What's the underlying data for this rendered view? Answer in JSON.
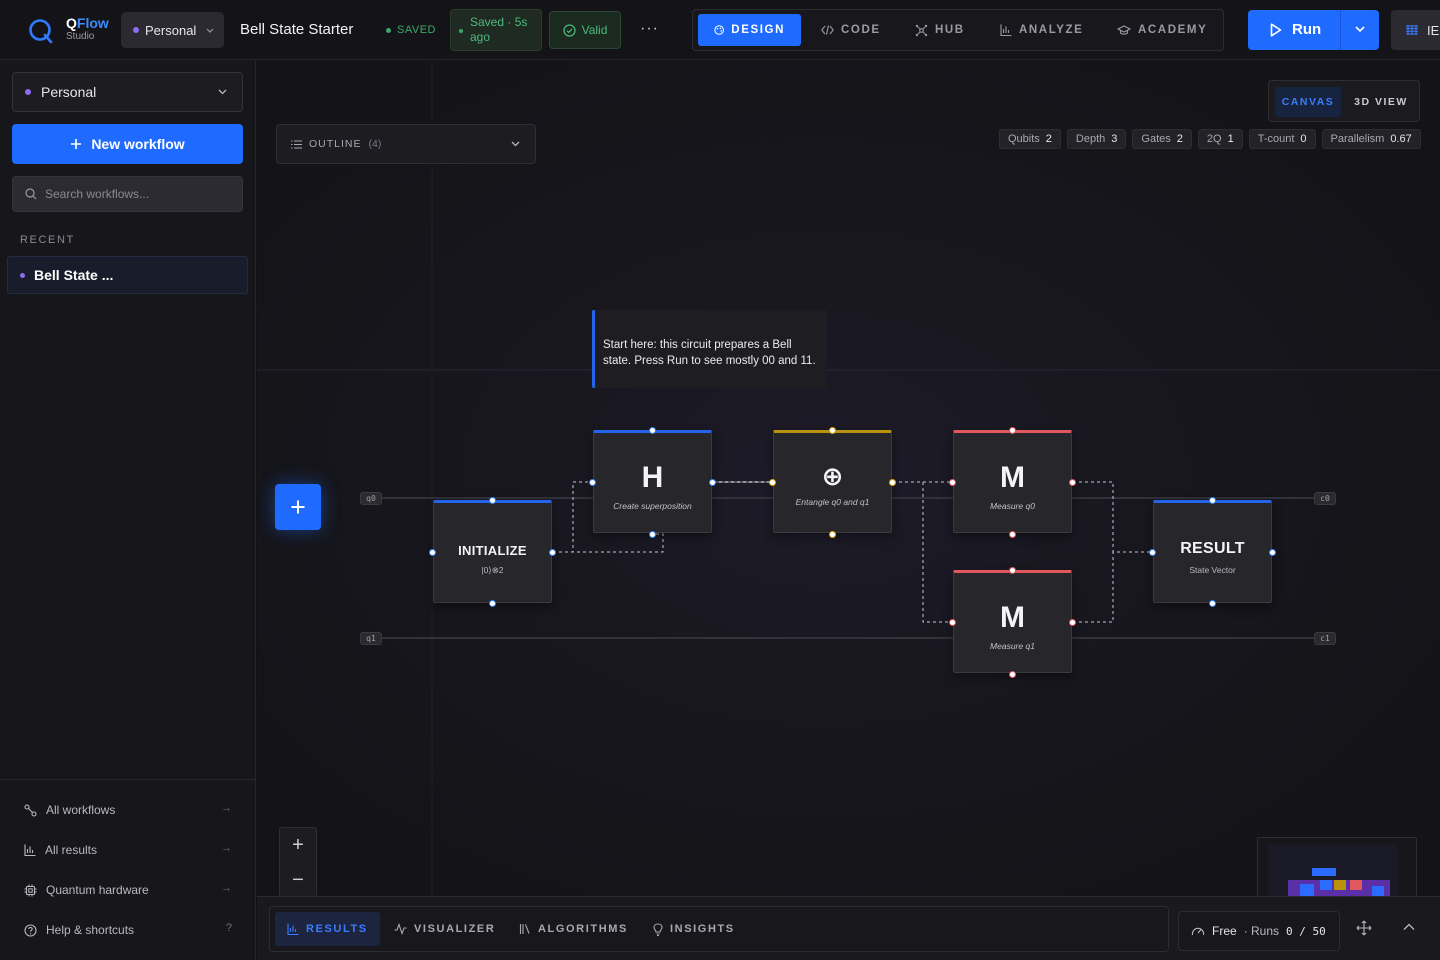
{
  "app": {
    "brand_prefix": "Q",
    "brand_suffix": "Flow",
    "brand_sub": "Studio",
    "workspace": "Personal",
    "doc_title": "Bell State Starter",
    "saved_flag": "SAVED",
    "saved_ago": "Saved · 5s ago",
    "valid": "Valid",
    "more": "···"
  },
  "nav": [
    {
      "label": "DESIGN",
      "icon": "palette-icon",
      "active": true
    },
    {
      "label": "CODE",
      "icon": "code-icon"
    },
    {
      "label": "HUB",
      "icon": "hub-icon"
    },
    {
      "label": "ANALYZE",
      "icon": "bar-chart-icon"
    },
    {
      "label": "ACADEMY",
      "icon": "graduation-cap-icon"
    }
  ],
  "run": {
    "label": "Run"
  },
  "hardware_btn": {
    "label": "IE"
  },
  "sidebar": {
    "workspace": "Personal",
    "new_workflow": "New workflow",
    "search_placeholder": "Search workflows...",
    "recent_heading": "RECENT",
    "recent_items": [
      "Bell State ..."
    ],
    "links": [
      {
        "label": "All workflows",
        "icon": "workflow-icon",
        "hint": "→"
      },
      {
        "label": "All results",
        "icon": "bar-chart-icon",
        "hint": "→"
      },
      {
        "label": "Quantum hardware",
        "icon": "chip-icon",
        "hint": "→"
      },
      {
        "label": "Help & shortcuts",
        "icon": "help-icon",
        "hint": "?"
      }
    ]
  },
  "canvas": {
    "view_toggle": {
      "canvas": "CANVAS",
      "view3d": "3D VIEW",
      "active": "canvas"
    },
    "outline": {
      "label": "OUTLINE",
      "count": "(4)"
    },
    "stats": [
      {
        "label": "Qubits",
        "value": "2"
      },
      {
        "label": "Depth",
        "value": "3"
      },
      {
        "label": "Gates",
        "value": "2"
      },
      {
        "label": "2Q",
        "value": "1"
      },
      {
        "label": "T-count",
        "value": "0"
      },
      {
        "label": "Parallelism",
        "value": "0.67"
      }
    ],
    "tooltip": "Start here: this circuit prepares a Bell state. Press Run to see mostly 00 and 11.",
    "wires": {
      "q0": "q0",
      "q1": "q1",
      "c0": "c0",
      "c1": "c1"
    },
    "nodes": {
      "init": {
        "title": "INITIALIZE",
        "sub": "|0⟩⊗2"
      },
      "h": {
        "symbol": "H",
        "desc": "Create superposition"
      },
      "cnot": {
        "symbol": "⊕",
        "desc": "Entangle q0 and q1"
      },
      "m0": {
        "symbol": "M",
        "desc": "Measure q0"
      },
      "m1": {
        "symbol": "M",
        "desc": "Measure q1"
      },
      "result": {
        "title": "RESULT",
        "sub": "State Vector"
      }
    },
    "zoom": {
      "in": "+",
      "out": "−"
    }
  },
  "bottom": {
    "tabs": [
      {
        "label": "RESULTS",
        "icon": "bar-chart-icon",
        "active": true
      },
      {
        "label": "VISUALIZER",
        "icon": "pulse-icon"
      },
      {
        "label": "ALGORITHMS",
        "icon": "library-icon"
      },
      {
        "label": "INSIGHTS",
        "icon": "lightbulb-icon"
      }
    ],
    "plan": {
      "tier": "Free",
      "runs_label": "· Runs",
      "runs_value": "0 / 50"
    }
  },
  "colors": {
    "accent": "#1f6bff",
    "gate_blue": "#2563eb",
    "gate_yellow": "#b9920f",
    "gate_red": "#e0575e",
    "success": "#39a96b",
    "workspace_dot": "#8b6cf2"
  }
}
